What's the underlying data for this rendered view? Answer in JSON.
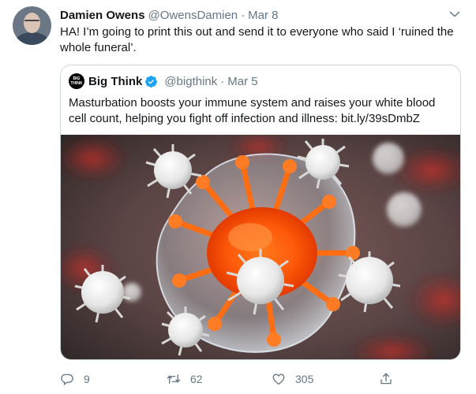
{
  "tweet": {
    "author_name": "Damien Owens",
    "author_handle": "@OwensDamien",
    "separator": "·",
    "date": "Mar 8",
    "text": "HA! I’m going to print this out and send it to everyone who said I ‘ruined the whole funeral’.",
    "avatar_icon": "user-photo"
  },
  "quote": {
    "logo_text": "BIG THINK",
    "author_name": "Big Think",
    "author_handle": "@bigthink",
    "separator": "·",
    "date": "Mar 5",
    "text": "Masturbation boosts your immune system and raises your white blood cell count, helping you fight off infection and illness: bit.ly/39sDmbZ",
    "verified_icon": "verified-badge-icon",
    "image_description_icon": "virus-cell-illustration"
  },
  "actions": {
    "reply_count": "9",
    "retweet_count": "62",
    "like_count": "305",
    "reply_icon": "reply-icon",
    "retweet_icon": "retweet-icon",
    "like_icon": "heart-icon",
    "share_icon": "share-icon"
  },
  "colors": {
    "text": "#14171a",
    "muted": "#657786",
    "border": "#ccd6dd",
    "verified": "#1da1f2",
    "background": "#ffffff"
  }
}
